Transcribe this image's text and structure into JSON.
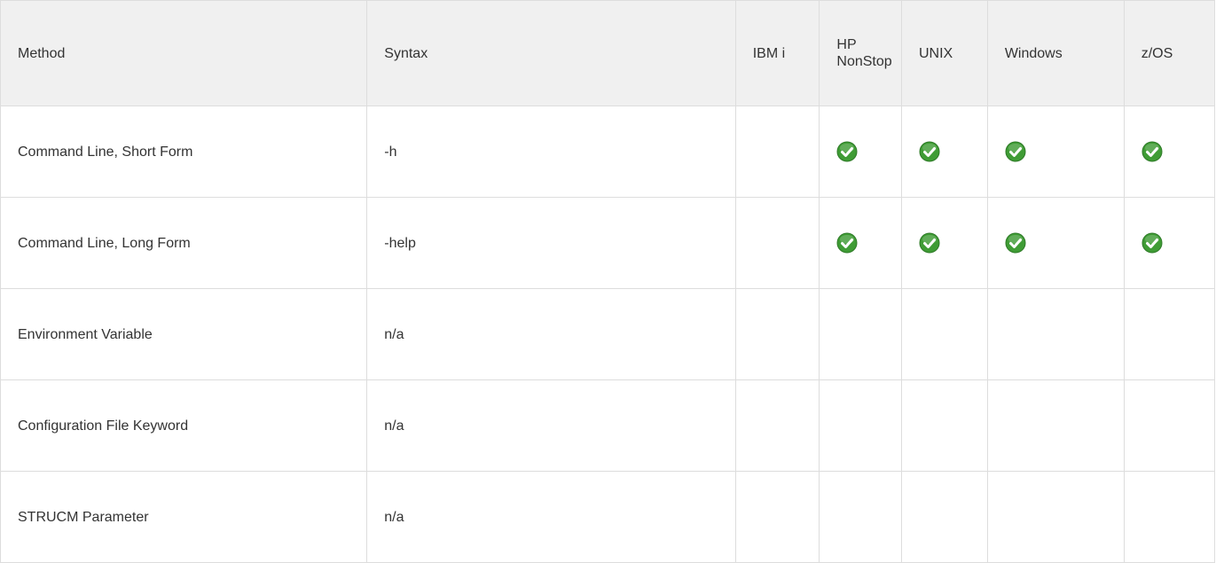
{
  "table": {
    "headers": [
      "Method",
      "Syntax",
      "IBM i",
      "HP NonStop",
      "UNIX",
      "Windows",
      "z/OS"
    ],
    "rows": [
      {
        "method": "Command Line, Short Form",
        "syntax": "-h",
        "ibm_i": "",
        "hp_nonstop": "check-icon",
        "unix": "check-icon",
        "windows": "check-icon",
        "zos": "check-icon"
      },
      {
        "method": "Command Line, Long Form",
        "syntax": "-help",
        "ibm_i": "",
        "hp_nonstop": "check-icon",
        "unix": "check-icon",
        "windows": "check-icon",
        "zos": "check-icon"
      },
      {
        "method": "Environment Variable",
        "syntax": "n/a",
        "ibm_i": "",
        "hp_nonstop": "",
        "unix": "",
        "windows": "",
        "zos": ""
      },
      {
        "method": "Configuration File Keyword",
        "syntax": "n/a",
        "ibm_i": "",
        "hp_nonstop": "",
        "unix": "",
        "windows": "",
        "zos": ""
      },
      {
        "method": "STRUCM Parameter",
        "syntax": "n/a",
        "ibm_i": "",
        "hp_nonstop": "",
        "unix": "",
        "windows": "",
        "zos": ""
      }
    ]
  },
  "colors": {
    "header_bg": "#f0f0f0",
    "border": "#dddddd",
    "text": "#333333",
    "check_green": "#3f9c35"
  }
}
